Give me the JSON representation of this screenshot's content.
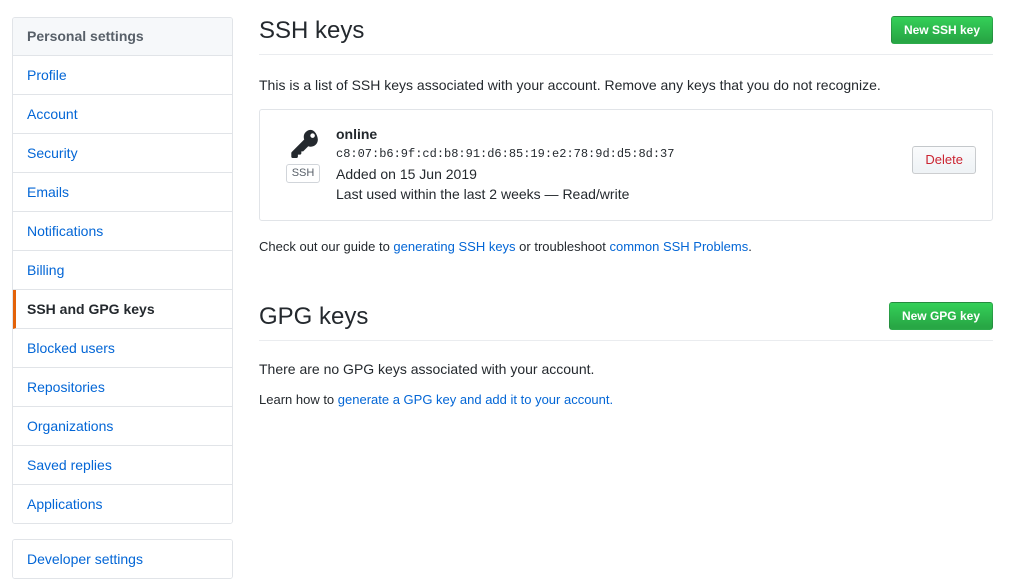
{
  "sidebar": {
    "header": "Personal settings",
    "items": [
      {
        "label": "Profile",
        "selected": false
      },
      {
        "label": "Account",
        "selected": false
      },
      {
        "label": "Security",
        "selected": false
      },
      {
        "label": "Emails",
        "selected": false
      },
      {
        "label": "Notifications",
        "selected": false
      },
      {
        "label": "Billing",
        "selected": false
      },
      {
        "label": "SSH and GPG keys",
        "selected": true
      },
      {
        "label": "Blocked users",
        "selected": false
      },
      {
        "label": "Repositories",
        "selected": false
      },
      {
        "label": "Organizations",
        "selected": false
      },
      {
        "label": "Saved replies",
        "selected": false
      },
      {
        "label": "Applications",
        "selected": false
      }
    ],
    "developer_settings": "Developer settings",
    "accent_color": "#e36209",
    "link_color": "#0366d6"
  },
  "ssh_section": {
    "title": "SSH keys",
    "new_button": "New SSH key",
    "description": "This is a list of SSH keys associated with your account. Remove any keys that you do not recognize.",
    "key": {
      "icon": "key-icon",
      "badge": "SSH",
      "title": "online",
      "fingerprint": "c8:07:b6:9f:cd:b8:91:d6:85:19:e2:78:9d:d5:8d:37",
      "added": "Added on 15 Jun 2019",
      "last_used": "Last used within the last 2 weeks — Read/write",
      "delete_label": "Delete"
    },
    "help": {
      "prefix": "Check out our guide to ",
      "link1": "generating SSH keys",
      "middle": " or troubleshoot ",
      "link2": "common SSH Problems",
      "suffix": "."
    }
  },
  "gpg_section": {
    "title": "GPG keys",
    "new_button": "New GPG key",
    "empty_message": "There are no GPG keys associated with your account.",
    "learn": {
      "prefix": "Learn how to ",
      "link": "generate a GPG key and add it to your account."
    }
  },
  "colors": {
    "green_button": "#28a745",
    "delete_text": "#cb2431",
    "border": "#e1e4e8"
  }
}
